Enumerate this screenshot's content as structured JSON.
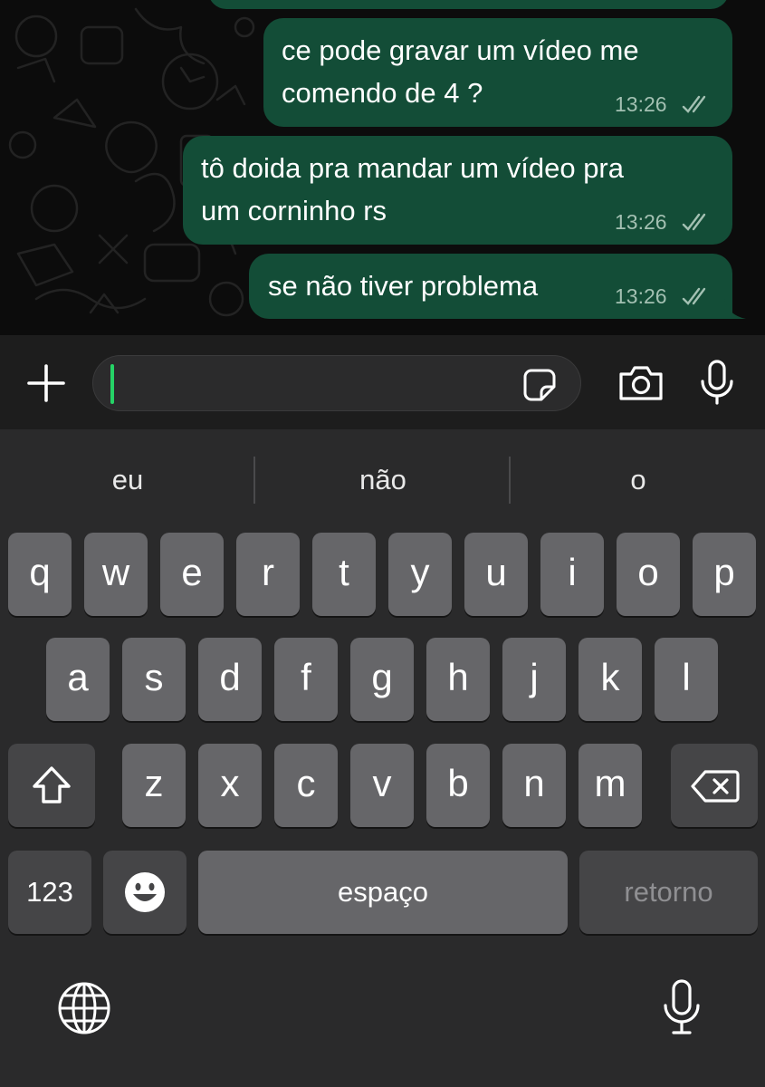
{
  "chat": {
    "messages": [
      {
        "text": "ce pode gravar um vídeo me\ncomendo de 4 ?",
        "time": "13:26",
        "status": "read"
      },
      {
        "text": "tô doida pra mandar um vídeo pra\num corninho rs",
        "time": "13:26",
        "status": "read"
      },
      {
        "text": "se não tiver problema",
        "time": "13:26",
        "status": "read"
      }
    ]
  },
  "input_bar": {
    "message_value": "",
    "icons": [
      "plus-icon",
      "sticker-icon",
      "camera-icon",
      "microphone-icon"
    ]
  },
  "keyboard": {
    "suggestions": [
      "eu",
      "não",
      "o"
    ],
    "row1": [
      "q",
      "w",
      "e",
      "r",
      "t",
      "y",
      "u",
      "i",
      "o",
      "p"
    ],
    "row2": [
      "a",
      "s",
      "d",
      "f",
      "g",
      "h",
      "j",
      "k",
      "l"
    ],
    "row3": [
      "z",
      "x",
      "c",
      "v",
      "b",
      "n",
      "m"
    ],
    "numbers_label": "123",
    "space_label": "espaço",
    "return_label": "retorno",
    "icons": [
      "shift-icon",
      "backspace-icon",
      "emoji-icon",
      "globe-icon",
      "dictation-icon"
    ]
  },
  "colors": {
    "bubble": "#134d37",
    "caret": "#25d366",
    "keyboard_bg": "#2a2a2b",
    "key": "#666669",
    "key_dark": "#454547"
  }
}
